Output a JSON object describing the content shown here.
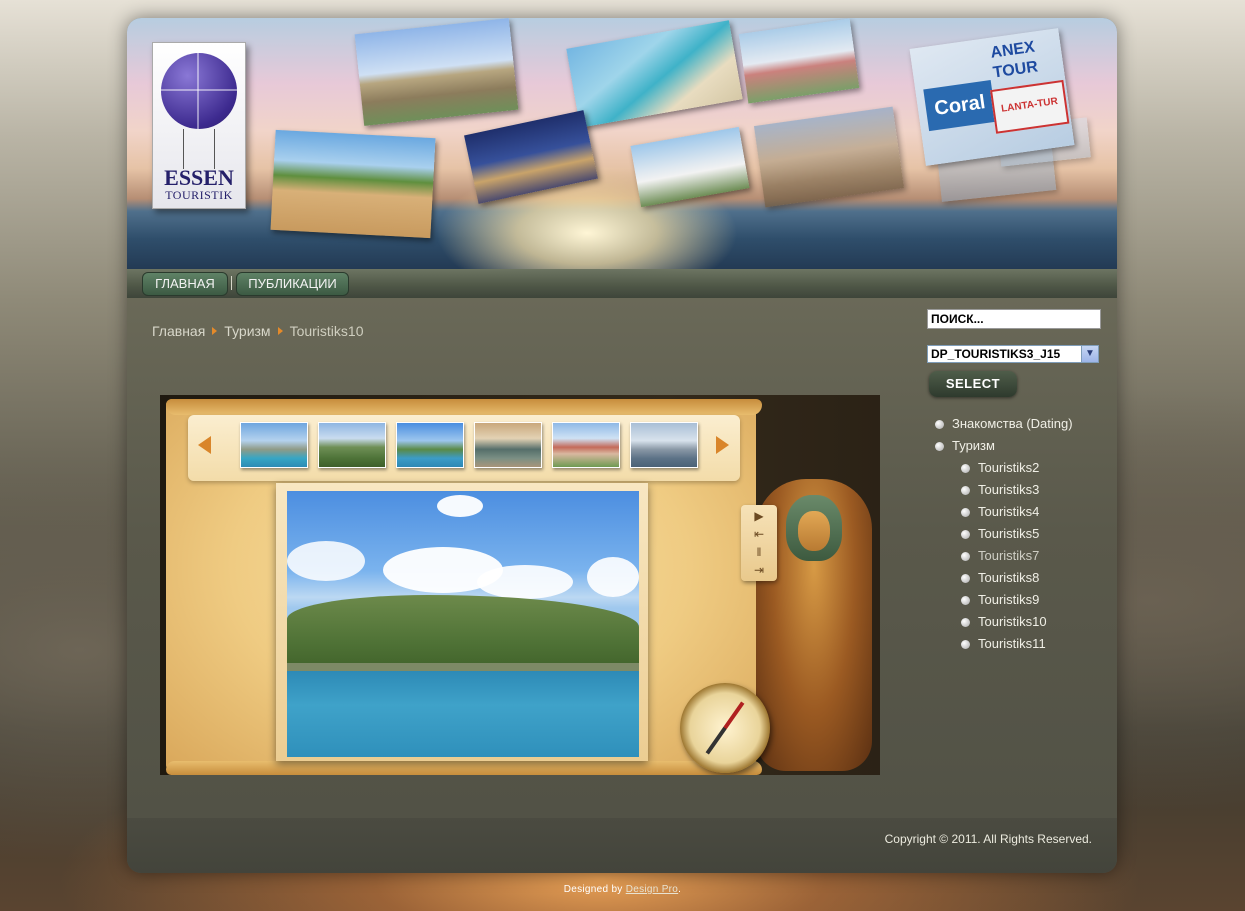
{
  "header": {
    "logo": {
      "brand": "ESSEN",
      "sub": "TOURISTIK"
    },
    "tour_logos": [
      "Coral",
      "ANEX TOUR",
      "LANTA-TUR"
    ]
  },
  "nav": {
    "items": [
      {
        "label": "ГЛАВНАЯ"
      },
      {
        "label": "ПУБЛИКАЦИИ"
      }
    ]
  },
  "breadcrumb": {
    "items": [
      "Главная",
      "Туризм",
      "Touristiks10"
    ]
  },
  "search": {
    "placeholder": "ПОИСК..."
  },
  "template_select": {
    "value": "DP_TOURISTIKS3_J15"
  },
  "select_button": {
    "label": "SELECT"
  },
  "menu": {
    "items": [
      {
        "label": "Знакомства (Dating)",
        "level": 0
      },
      {
        "label": "Туризм",
        "level": 0
      },
      {
        "label": "Touristiks2",
        "level": 1
      },
      {
        "label": "Touristiks3",
        "level": 1
      },
      {
        "label": "Touristiks4",
        "level": 1
      },
      {
        "label": "Touristiks5",
        "level": 1
      },
      {
        "label": "Touristiks7",
        "level": 1
      },
      {
        "label": "Touristiks8",
        "level": 1
      },
      {
        "label": "Touristiks9",
        "level": 1
      },
      {
        "label": "Touristiks10",
        "level": 1
      },
      {
        "label": "Touristiks11",
        "level": 1
      }
    ]
  },
  "footer": {
    "copyright": "Copyright © 2011. All Rights Reserved.",
    "designed_prefix": "Designed by ",
    "designed_link": "Design Pro",
    "designed_suffix": "."
  }
}
